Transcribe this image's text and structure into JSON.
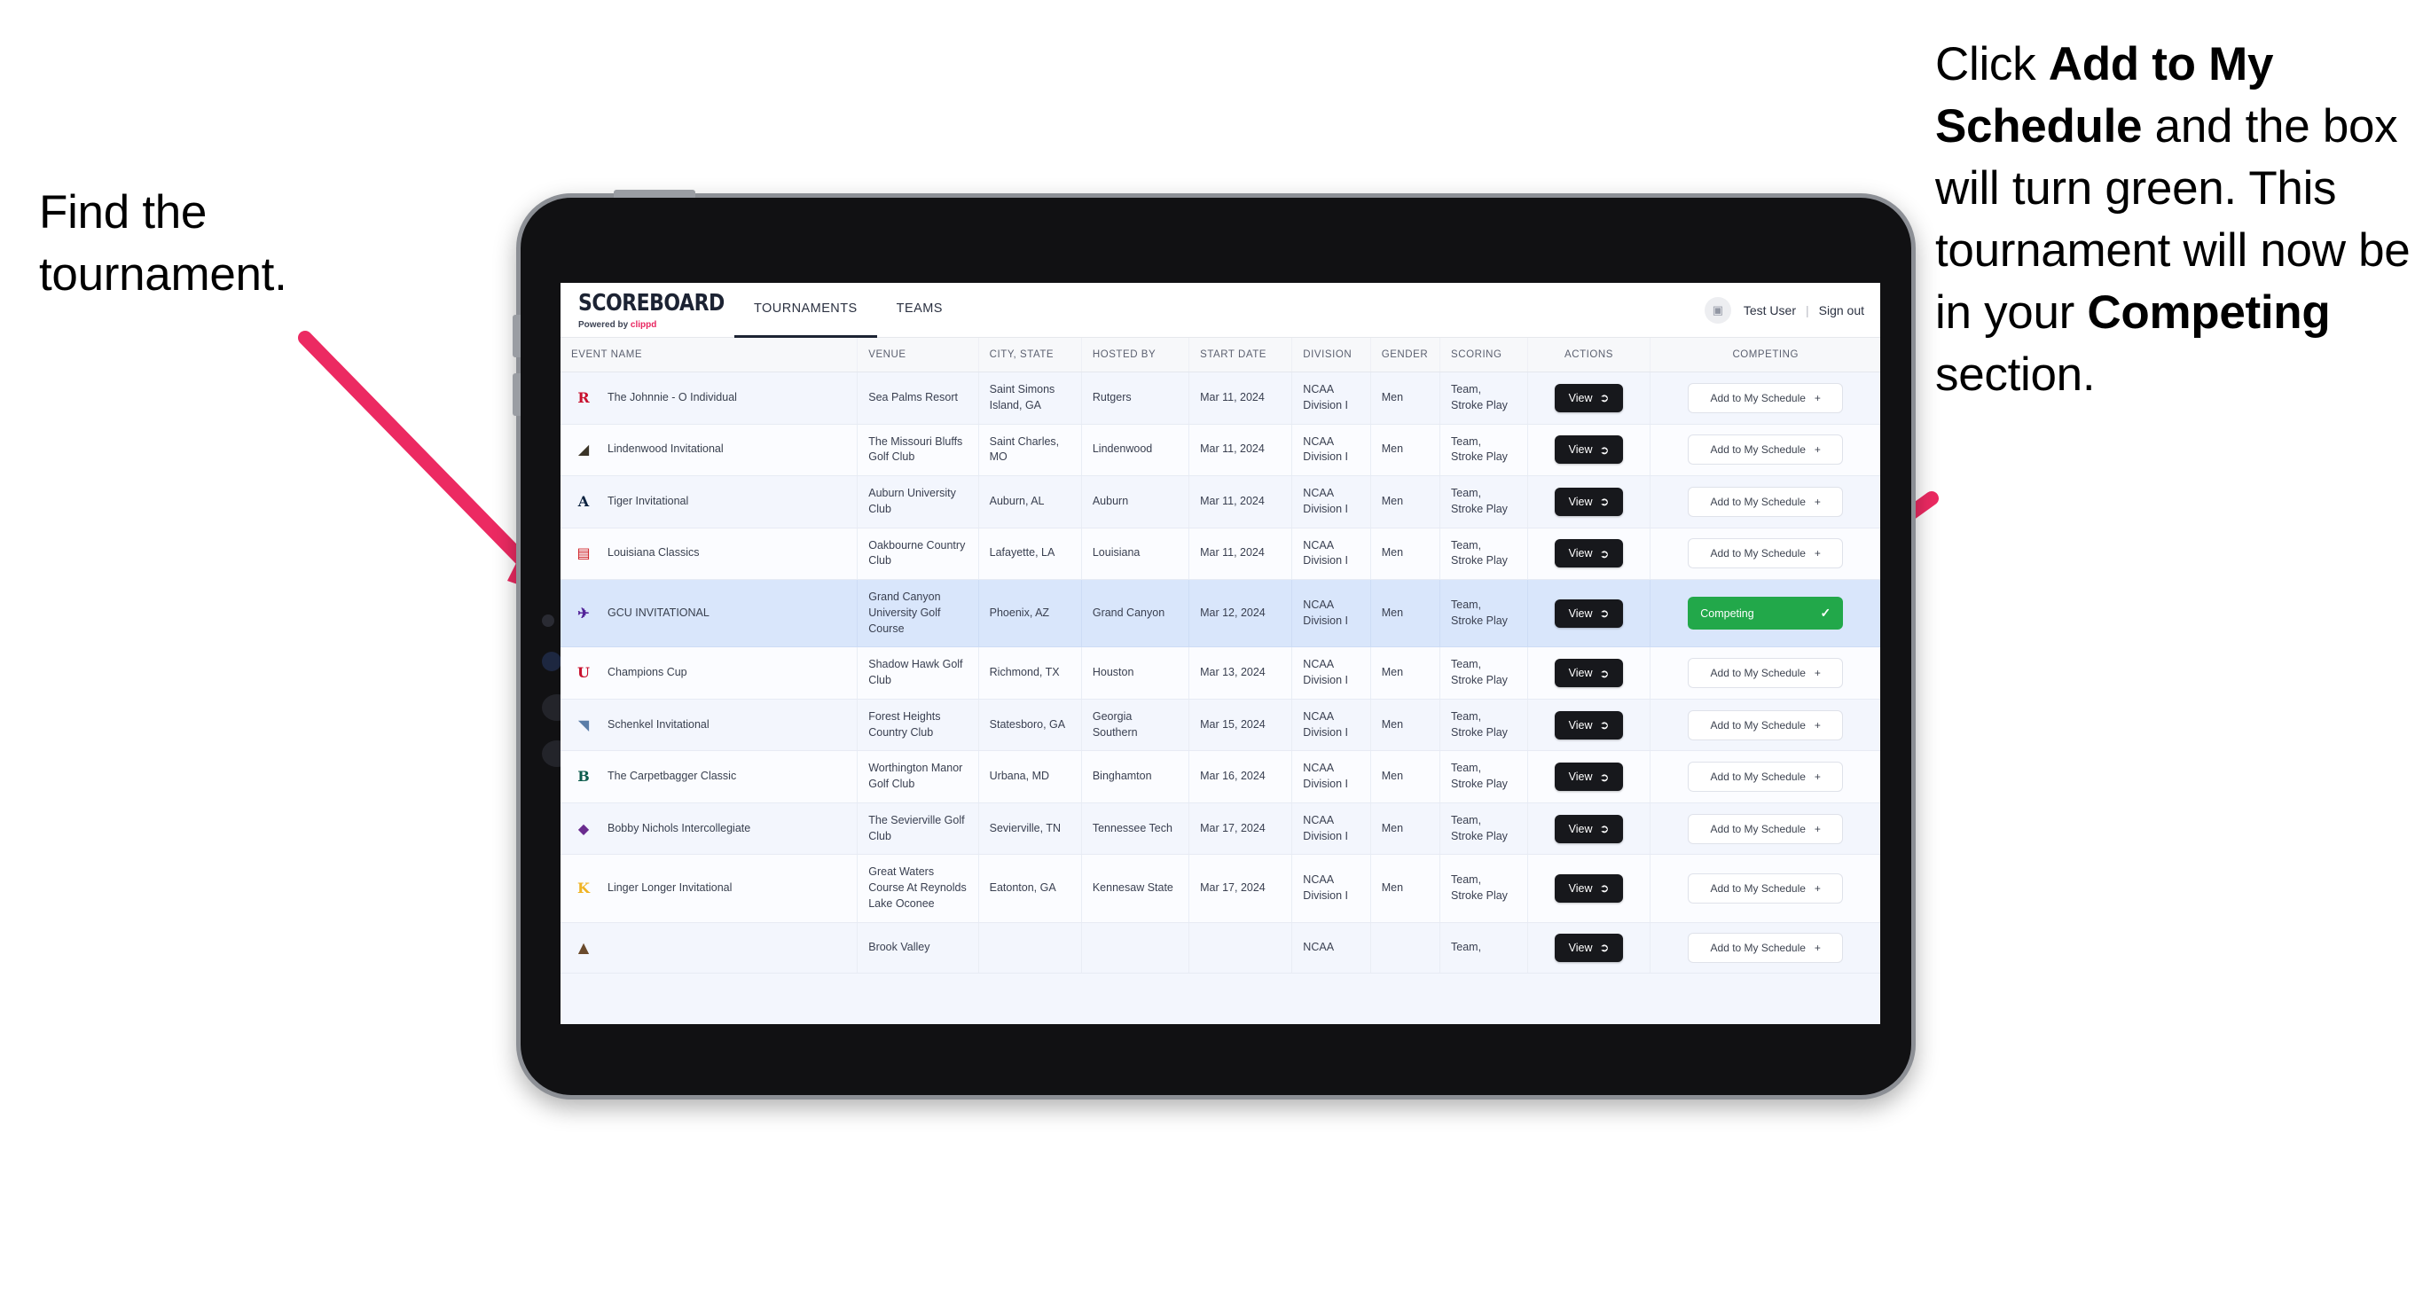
{
  "annotations": {
    "left": "Find the tournament.",
    "right_parts": [
      {
        "text": "Click ",
        "bold": false
      },
      {
        "text": "Add to My Schedule",
        "bold": true
      },
      {
        "text": " and the box will turn green. This tournament will now be in your ",
        "bold": false
      },
      {
        "text": "Competing",
        "bold": true
      },
      {
        "text": " section.",
        "bold": false
      }
    ],
    "arrow_color": "#ec2a62"
  },
  "app": {
    "brand": {
      "name": "SCOREBOARD",
      "powered_prefix": "Powered by ",
      "powered_brand": "clippd",
      "accent": "#e8255f"
    },
    "tabs": [
      {
        "label": "TOURNAMENTS",
        "active": true
      },
      {
        "label": "TEAMS",
        "active": false
      }
    ],
    "user": {
      "name": "Test User",
      "separator": "|",
      "signout": "Sign out",
      "avatar_glyph": "▣"
    }
  },
  "table": {
    "headers": [
      "EVENT NAME",
      "VENUE",
      "CITY, STATE",
      "HOSTED BY",
      "START DATE",
      "DIVISION",
      "GENDER",
      "SCORING",
      "ACTIONS",
      "COMPETING"
    ],
    "view_label": "View",
    "add_label": "Add to My Schedule",
    "add_icon": "+",
    "competing_label": "Competing",
    "competing_icon": "✓",
    "competing_color": "#22a84a",
    "rows": [
      {
        "name": "The Johnnie - O Individual",
        "venue": "Sea Palms Resort",
        "city": "Saint Simons Island, GA",
        "host": "Rutgers",
        "date": "Mar 11, 2024",
        "division": "NCAA Division I",
        "gender": "Men",
        "scoring": "Team, Stroke Play",
        "competing": false,
        "logo": "rutgers-logo"
      },
      {
        "name": "Lindenwood Invitational",
        "venue": "The Missouri Bluffs Golf Club",
        "city": "Saint Charles, MO",
        "host": "Lindenwood",
        "date": "Mar 11, 2024",
        "division": "NCAA Division I",
        "gender": "Men",
        "scoring": "Team, Stroke Play",
        "competing": false,
        "logo": "lindenwood-logo"
      },
      {
        "name": "Tiger Invitational",
        "venue": "Auburn University Club",
        "city": "Auburn, AL",
        "host": "Auburn",
        "date": "Mar 11, 2024",
        "division": "NCAA Division I",
        "gender": "Men",
        "scoring": "Team, Stroke Play",
        "competing": false,
        "logo": "auburn-logo"
      },
      {
        "name": "Louisiana Classics",
        "venue": "Oakbourne Country Club",
        "city": "Lafayette, LA",
        "host": "Louisiana",
        "date": "Mar 11, 2024",
        "division": "NCAA Division I",
        "gender": "Men",
        "scoring": "Team, Stroke Play",
        "competing": false,
        "logo": "ragin-cajuns-logo"
      },
      {
        "name": "GCU INVITATIONAL",
        "venue": "Grand Canyon University Golf Course",
        "city": "Phoenix, AZ",
        "host": "Grand Canyon",
        "date": "Mar 12, 2024",
        "division": "NCAA Division I",
        "gender": "Men",
        "scoring": "Team, Stroke Play",
        "competing": true,
        "logo": "grand-canyon-logo"
      },
      {
        "name": "Champions Cup",
        "venue": "Shadow Hawk Golf Club",
        "city": "Richmond, TX",
        "host": "Houston",
        "date": "Mar 13, 2024",
        "division": "NCAA Division I",
        "gender": "Men",
        "scoring": "Team, Stroke Play",
        "competing": false,
        "logo": "houston-logo"
      },
      {
        "name": "Schenkel Invitational",
        "venue": "Forest Heights Country Club",
        "city": "Statesboro, GA",
        "host": "Georgia Southern",
        "date": "Mar 15, 2024",
        "division": "NCAA Division I",
        "gender": "Men",
        "scoring": "Team, Stroke Play",
        "competing": false,
        "logo": "georgia-southern-logo"
      },
      {
        "name": "The Carpetbagger Classic",
        "venue": "Worthington Manor Golf Club",
        "city": "Urbana, MD",
        "host": "Binghamton",
        "date": "Mar 16, 2024",
        "division": "NCAA Division I",
        "gender": "Men",
        "scoring": "Team, Stroke Play",
        "competing": false,
        "logo": "binghamton-logo"
      },
      {
        "name": "Bobby Nichols Intercollegiate",
        "venue": "The Sevierville Golf Club",
        "city": "Sevierville, TN",
        "host": "Tennessee Tech",
        "date": "Mar 17, 2024",
        "division": "NCAA Division I",
        "gender": "Men",
        "scoring": "Team, Stroke Play",
        "competing": false,
        "logo": "tennessee-tech-logo"
      },
      {
        "name": "Linger Longer Invitational",
        "venue": "Great Waters Course At Reynolds Lake Oconee",
        "city": "Eatonton, GA",
        "host": "Kennesaw State",
        "date": "Mar 17, 2024",
        "division": "NCAA Division I",
        "gender": "Men",
        "scoring": "Team, Stroke Play",
        "competing": false,
        "logo": "kennesaw-state-logo"
      },
      {
        "name": "",
        "venue": "Brook Valley",
        "city": "",
        "host": "",
        "date": "",
        "division": "NCAA",
        "gender": "",
        "scoring": "Team,",
        "competing": false,
        "logo": "partial-logo"
      }
    ]
  }
}
